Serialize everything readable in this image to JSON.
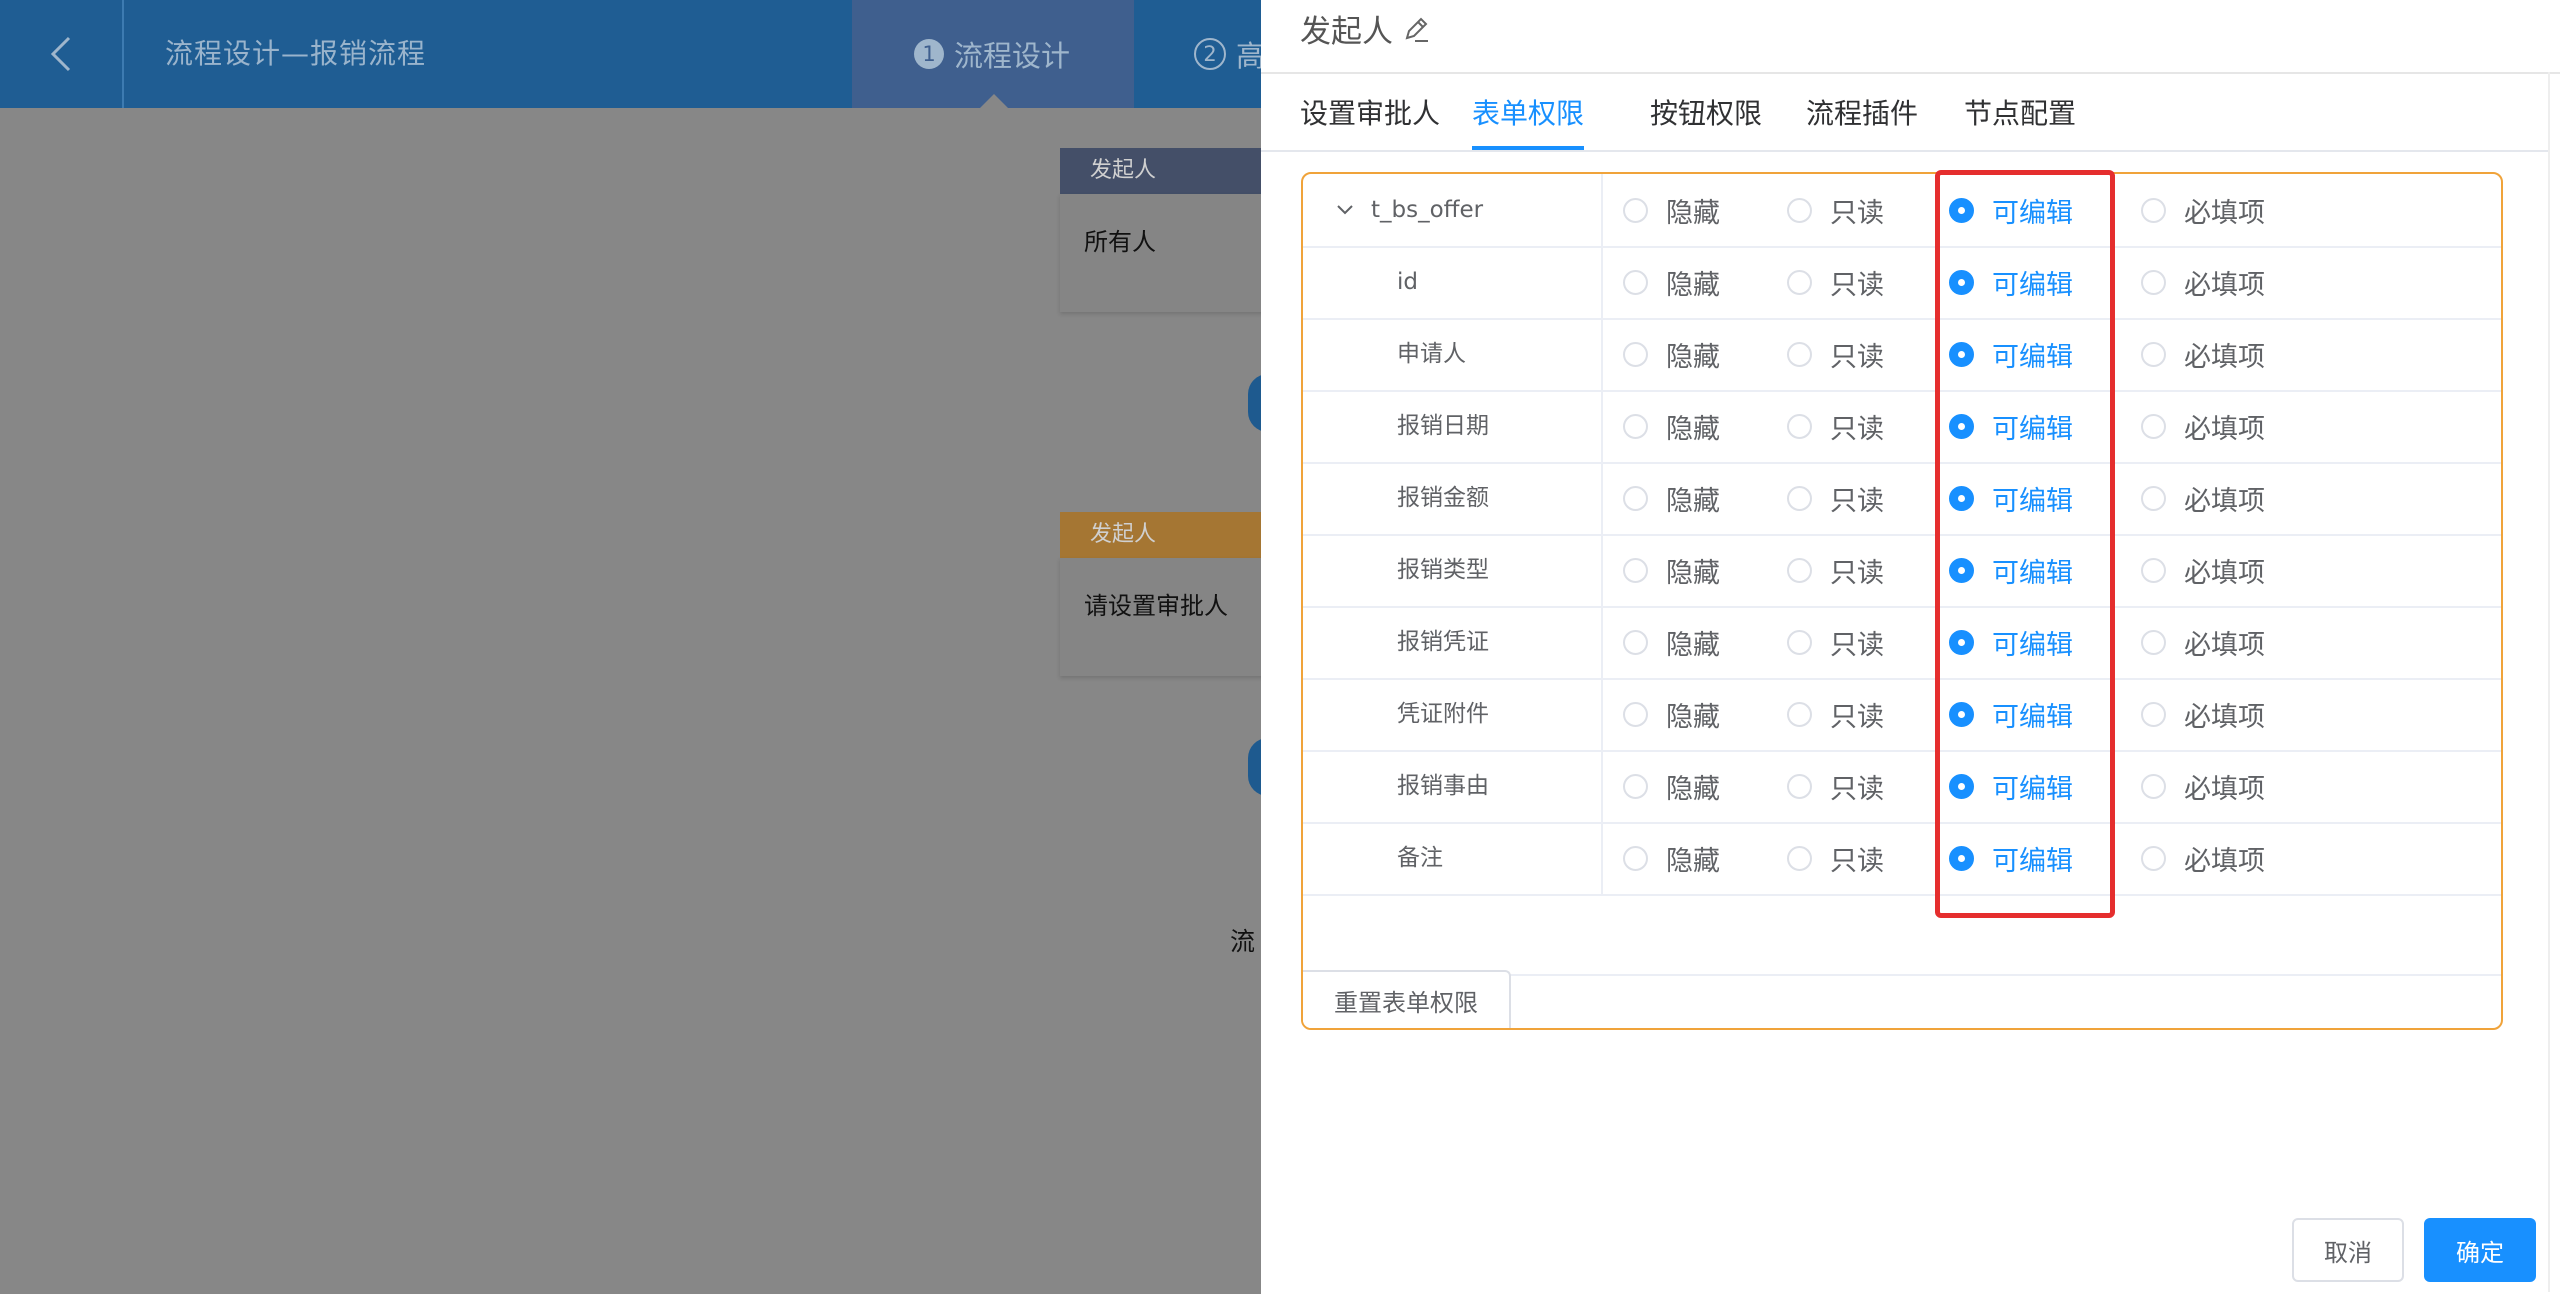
{
  "app": {
    "title": "流程设计—报销流程",
    "steps": [
      {
        "num": "1",
        "label": "流程设计"
      },
      {
        "num": "2",
        "label": "高"
      }
    ]
  },
  "canvas": {
    "nodes": [
      {
        "header": "发起人",
        "body": "所有人"
      },
      {
        "header": "发起人",
        "body": "请设置审批人"
      }
    ],
    "flow_label": "流"
  },
  "drawer": {
    "title": "发起人",
    "tabs": [
      "设置审批人",
      "表单权限",
      "按钮权限",
      "流程插件",
      "节点配置"
    ],
    "active_tab": "表单权限",
    "options": [
      "隐藏",
      "只读",
      "可编辑",
      "必填项"
    ],
    "rows": [
      {
        "field": "t_bs_offer",
        "selected": "可编辑"
      },
      {
        "field": "id",
        "selected": "可编辑"
      },
      {
        "field": "申请人",
        "selected": "可编辑"
      },
      {
        "field": "报销日期",
        "selected": "可编辑"
      },
      {
        "field": "报销金额",
        "selected": "可编辑"
      },
      {
        "field": "报销类型",
        "selected": "可编辑"
      },
      {
        "field": "报销凭证",
        "selected": "可编辑"
      },
      {
        "field": "凭证附件",
        "selected": "可编辑"
      },
      {
        "field": "报销事由",
        "selected": "可编辑"
      },
      {
        "field": "备注",
        "selected": "可编辑"
      }
    ],
    "reset_label": "重置表单权限",
    "cancel_label": "取消",
    "confirm_label": "确定"
  },
  "colors": {
    "primary": "#1890ff",
    "highlight": "#e52e2e",
    "table_border": "#f0a33a",
    "topbar": "#1f5d93"
  },
  "icons": [
    "back-arrow-icon",
    "edit-pen-icon",
    "chevron-down-icon"
  ]
}
